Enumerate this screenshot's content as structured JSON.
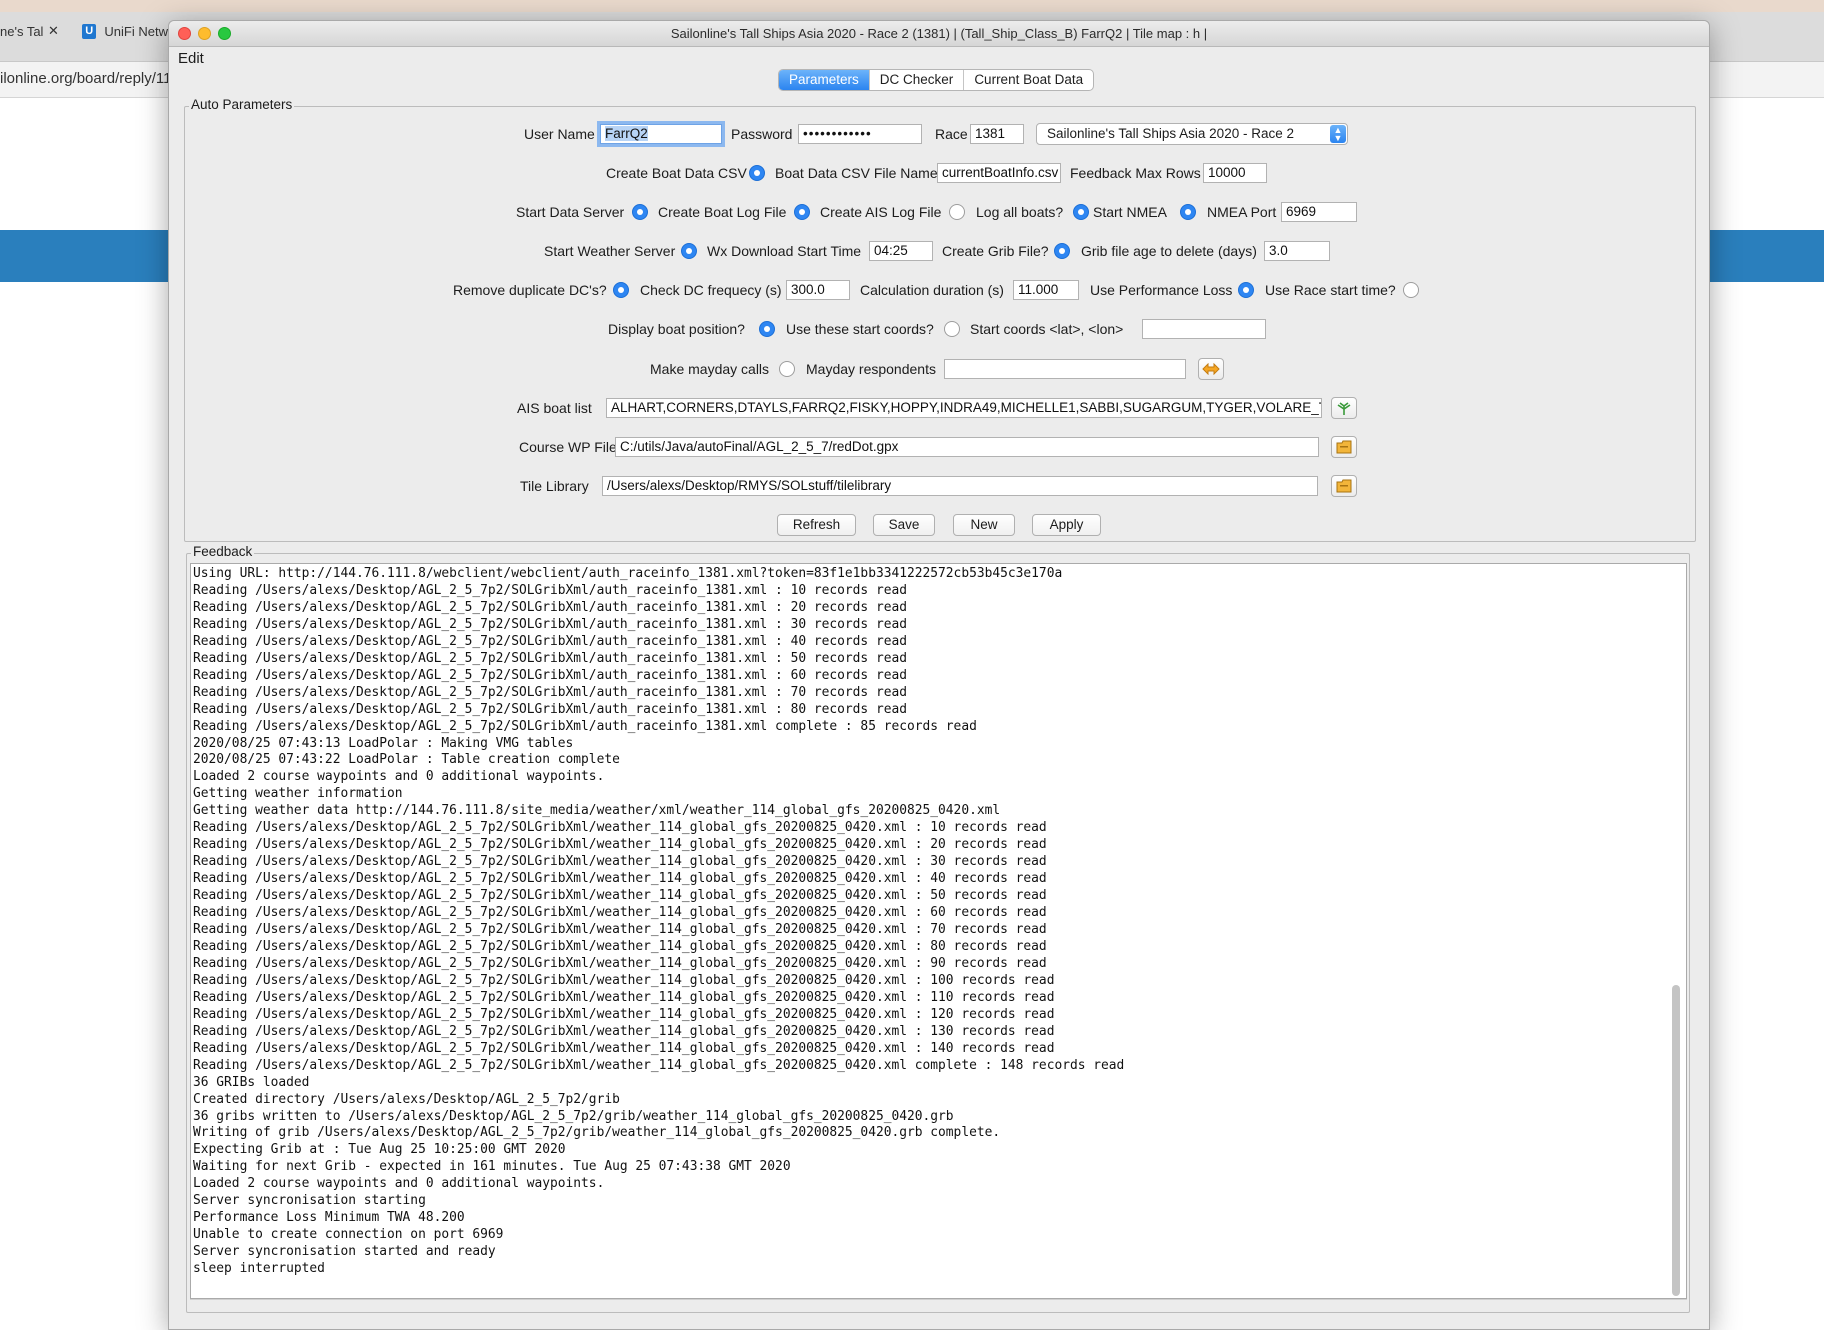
{
  "browser": {
    "tab1": "ne's Tal",
    "tab1_close": "✕",
    "tab2": "UniFi Netw",
    "url": "ilonline.org/board/reply/11"
  },
  "window": {
    "title": "Sailonline's Tall Ships Asia 2020 - Race 2 (1381) | (Tall_Ship_Class_B) FarrQ2 | Tile map : h |",
    "menu": [
      "Edit"
    ]
  },
  "tabs": [
    {
      "label": "Parameters",
      "active": true
    },
    {
      "label": "DC Checker",
      "active": false
    },
    {
      "label": "Current Boat Data",
      "active": false
    }
  ],
  "auto": {
    "group_title": "Auto Parameters",
    "user_name_label": "User Name",
    "user_name": "FarrQ2",
    "password_label": "Password",
    "password": "••••••••••••",
    "race_label": "Race",
    "race": "1381",
    "race_select": "Sailonline's Tall Ships Asia 2020 - Race 2",
    "create_csv_label": "Create Boat Data CSV",
    "csv_name_label": "Boat Data CSV File Name",
    "csv_name": "currentBoatInfo.csv",
    "feedback_rows_label": "Feedback Max Rows",
    "feedback_rows": "10000",
    "start_data_server_label": "Start Data Server",
    "create_log_label": "Create Boat Log File",
    "create_ais_label": "Create AIS Log File",
    "log_all_label": "Log all boats?",
    "start_nmea_label": "Start NMEA",
    "nmea_port_label": "NMEA Port",
    "nmea_port": "6969",
    "start_weather_label": "Start Weather Server",
    "wx_start_label": "Wx Download Start Time",
    "wx_start": "04:25",
    "create_grib_label": "Create Grib File?",
    "grib_age_label": "Grib file age to delete (days)",
    "grib_age": "3.0",
    "remove_dup_label": "Remove duplicate DC's?",
    "check_dc_label": "Check DC frequecy (s)",
    "check_dc": "300.0",
    "calc_dur_label": "Calculation duration (s)",
    "calc_dur": "11.000",
    "perf_loss_label": "Use Performance Loss",
    "race_start_label": "Use Race start time?",
    "display_pos_label": "Display boat position?",
    "use_coords_label": "Use these start coords?",
    "start_coords_label": "Start coords <lat>, <lon>",
    "start_coords": "",
    "mayday_label": "Make mayday calls",
    "mayday_resp_label": "Mayday respondents",
    "mayday_resp": "",
    "ais_list_label": "AIS boat list",
    "ais_list": "ALHART,CORNERS,DTAYLS,FARRQ2,FISKY,HOPPY,INDRA49,MICHELLE1,SABBI,SUGARGUM,TYGER,VOLARE_TU,WRT,",
    "course_wp_label": "Course WP File",
    "course_wp": "C:/utils/Java/autoFinal/AGL_2_5_7/redDot.gpx",
    "tile_lib_label": "Tile Library",
    "tile_lib": "/Users/alexs/Desktop/RMYS/SOLstuff/tilelibrary",
    "buttons": {
      "refresh": "Refresh",
      "save": "Save",
      "new": "New",
      "apply": "Apply"
    },
    "radios": {
      "create_csv": true,
      "start_data_server": true,
      "create_log": true,
      "create_ais": false,
      "log_all": true,
      "start_nmea": true,
      "start_weather": true,
      "create_grib": true,
      "remove_dup": true,
      "perf_loss": true,
      "race_start": false,
      "display_pos": true,
      "use_coords": false,
      "mayday": false
    },
    "icons": {
      "mayday": "swap-arrows-icon",
      "ais": "antenna-icon",
      "course": "folder-icon",
      "tile": "folder-icon"
    }
  },
  "feedback": {
    "group_title": "Feedback",
    "lines": [
      "Using URL: http://144.76.111.8/webclient/webclient/auth_raceinfo_1381.xml?token=83f1e1bb3341222572cb53b45c3e170a",
      "Reading /Users/alexs/Desktop/AGL_2_5_7p2/SOLGribXml/auth_raceinfo_1381.xml : 10 records read",
      "Reading /Users/alexs/Desktop/AGL_2_5_7p2/SOLGribXml/auth_raceinfo_1381.xml : 20 records read",
      "Reading /Users/alexs/Desktop/AGL_2_5_7p2/SOLGribXml/auth_raceinfo_1381.xml : 30 records read",
      "Reading /Users/alexs/Desktop/AGL_2_5_7p2/SOLGribXml/auth_raceinfo_1381.xml : 40 records read",
      "Reading /Users/alexs/Desktop/AGL_2_5_7p2/SOLGribXml/auth_raceinfo_1381.xml : 50 records read",
      "Reading /Users/alexs/Desktop/AGL_2_5_7p2/SOLGribXml/auth_raceinfo_1381.xml : 60 records read",
      "Reading /Users/alexs/Desktop/AGL_2_5_7p2/SOLGribXml/auth_raceinfo_1381.xml : 70 records read",
      "Reading /Users/alexs/Desktop/AGL_2_5_7p2/SOLGribXml/auth_raceinfo_1381.xml : 80 records read",
      "Reading /Users/alexs/Desktop/AGL_2_5_7p2/SOLGribXml/auth_raceinfo_1381.xml complete : 85 records read",
      "2020/08/25 07:43:13 LoadPolar : Making VMG tables",
      "2020/08/25 07:43:22 LoadPolar : Table creation complete",
      "Loaded 2 course waypoints and 0 additional waypoints.",
      "Getting weather information",
      "Getting weather data http://144.76.111.8/site_media/weather/xml/weather_114_global_gfs_20200825_0420.xml",
      "Reading /Users/alexs/Desktop/AGL_2_5_7p2/SOLGribXml/weather_114_global_gfs_20200825_0420.xml : 10 records read",
      "Reading /Users/alexs/Desktop/AGL_2_5_7p2/SOLGribXml/weather_114_global_gfs_20200825_0420.xml : 20 records read",
      "Reading /Users/alexs/Desktop/AGL_2_5_7p2/SOLGribXml/weather_114_global_gfs_20200825_0420.xml : 30 records read",
      "Reading /Users/alexs/Desktop/AGL_2_5_7p2/SOLGribXml/weather_114_global_gfs_20200825_0420.xml : 40 records read",
      "Reading /Users/alexs/Desktop/AGL_2_5_7p2/SOLGribXml/weather_114_global_gfs_20200825_0420.xml : 50 records read",
      "Reading /Users/alexs/Desktop/AGL_2_5_7p2/SOLGribXml/weather_114_global_gfs_20200825_0420.xml : 60 records read",
      "Reading /Users/alexs/Desktop/AGL_2_5_7p2/SOLGribXml/weather_114_global_gfs_20200825_0420.xml : 70 records read",
      "Reading /Users/alexs/Desktop/AGL_2_5_7p2/SOLGribXml/weather_114_global_gfs_20200825_0420.xml : 80 records read",
      "Reading /Users/alexs/Desktop/AGL_2_5_7p2/SOLGribXml/weather_114_global_gfs_20200825_0420.xml : 90 records read",
      "Reading /Users/alexs/Desktop/AGL_2_5_7p2/SOLGribXml/weather_114_global_gfs_20200825_0420.xml : 100 records read",
      "Reading /Users/alexs/Desktop/AGL_2_5_7p2/SOLGribXml/weather_114_global_gfs_20200825_0420.xml : 110 records read",
      "Reading /Users/alexs/Desktop/AGL_2_5_7p2/SOLGribXml/weather_114_global_gfs_20200825_0420.xml : 120 records read",
      "Reading /Users/alexs/Desktop/AGL_2_5_7p2/SOLGribXml/weather_114_global_gfs_20200825_0420.xml : 130 records read",
      "Reading /Users/alexs/Desktop/AGL_2_5_7p2/SOLGribXml/weather_114_global_gfs_20200825_0420.xml : 140 records read",
      "Reading /Users/alexs/Desktop/AGL_2_5_7p2/SOLGribXml/weather_114_global_gfs_20200825_0420.xml complete : 148 records read",
      "36 GRIBs loaded",
      "Created directory /Users/alexs/Desktop/AGL_2_5_7p2/grib",
      "36 gribs written to /Users/alexs/Desktop/AGL_2_5_7p2/grib/weather_114_global_gfs_20200825_0420.grb",
      "Writing of grib /Users/alexs/Desktop/AGL_2_5_7p2/grib/weather_114_global_gfs_20200825_0420.grb complete.",
      "Expecting Grib at : Tue Aug 25 10:25:00 GMT 2020",
      "Waiting for next Grib - expected in 161 minutes. Tue Aug 25 07:43:38 GMT 2020",
      "Loaded 2 course waypoints and 0 additional waypoints.",
      "Server syncronisation starting",
      "Performance Loss Minimum TWA 48.200",
      "Unable to create connection on port 6969",
      "Server syncronisation started and ready",
      "sleep interrupted"
    ]
  },
  "colors": {
    "accent": "#2e86f2",
    "background_band": "#2a7fbd"
  }
}
